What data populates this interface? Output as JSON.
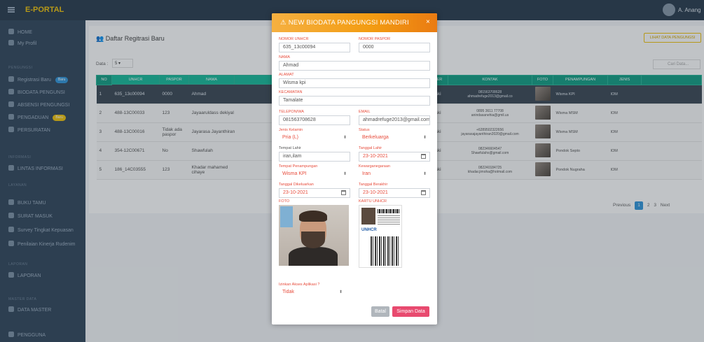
{
  "app": {
    "brand": "E-PORTAL",
    "user_name": "A. Anang"
  },
  "sidebar": {
    "items": [
      {
        "label": "HOME"
      },
      {
        "label": "My Profil"
      },
      {
        "label": "Registrasi Baru",
        "badge": "Baru"
      },
      {
        "label": "BIODATA PENGUNSI"
      },
      {
        "label": "ABSENSI PENGUNGSI"
      },
      {
        "label": "PENGADUAN",
        "badge": "Baru"
      },
      {
        "label": "PERSURATAN"
      },
      {
        "label": "LINTAS INFORMASI"
      },
      {
        "label": "BUKU TAMU"
      },
      {
        "label": "SURAT MASUK"
      },
      {
        "label": "Survey Tingkat Kepuasan"
      },
      {
        "label": "Penilaian Kinerja Rudenim"
      },
      {
        "label": "LAPORAN"
      },
      {
        "label": "DATA MASTER"
      },
      {
        "label": "PENGGUNA"
      }
    ],
    "sections": [
      "PENGUNGSI",
      "INFORMASI",
      "LAYANAN",
      "LAPORAN",
      "MASTER DATA"
    ]
  },
  "page": {
    "title": "Daftar Regitrasi Baru",
    "all_data_button": "LIHAT DATA PENGUNGSI",
    "data_label": "Data :",
    "data_count": "5",
    "search_placeholder": "Cari Data..."
  },
  "table": {
    "headers": [
      "NO",
      "UNHCR",
      "PASPOR",
      "NAMA",
      "GENDER",
      "KONTAK",
      "FOTO",
      "PENAMPUNGAN",
      "JENIS"
    ],
    "rows": [
      {
        "no": "1",
        "unhcr": "635_13c00094",
        "paspor": "0000",
        "nama": "Ahmad",
        "gender": "Laki-Laki",
        "kontak": "081563708628",
        "email": "ahmadrefuge2013@gmail.co",
        "penampungan": "Wisma KPI",
        "jenis": "IOM"
      },
      {
        "no": "2",
        "unhcr": "488-13C00033",
        "paspor": "123",
        "nama": "Jayaaruldass dekiyal",
        "gender": "Laki-Laki",
        "kontak": "0895 3611 77708",
        "email": "anindasanehia@gmil.us",
        "penampungan": "Wisma MSM",
        "jenis": "IOM"
      },
      {
        "no": "3",
        "unhcr": "488-13C00016",
        "paspor": "Tidak ada paspor",
        "nama": "Jayarasa Jayanthiran",
        "gender": "Laki-Laki",
        "kontak": "+6289502322656",
        "email": "jayarasajayanthiran2020@gmail.com",
        "penampungan": "Wisma MSM",
        "jenis": "IOM"
      },
      {
        "no": "4",
        "unhcr": "354-12C00671",
        "paspor": "No",
        "nama": "Shawfulah",
        "gender": "Laki-Laki",
        "kontak": "082346604547",
        "email": "Shawfulahs@gmail.com",
        "penampungan": "Pondok Septo",
        "jenis": "IOM"
      },
      {
        "no": "5",
        "unhcr": "186_14C03555",
        "paspor": "123",
        "nama": "Khadar mahamed cihaye",
        "gender": "Laki-Laki",
        "kontak": "082240184725",
        "email": "khadar.jimoha@hotmail.com",
        "penampungan": "Pondok Nugraha",
        "jenis": "IOM"
      }
    ]
  },
  "pagination": {
    "previous": "Previous",
    "pages": [
      "1",
      "2",
      "3"
    ],
    "next": "Next"
  },
  "modal": {
    "title": "NEW BIODATA PANGUNGSI MANDIRI",
    "close": "×",
    "fields": {
      "nomor_unhcr_label": "NOMOR UNHCR",
      "nomor_unhcr_value": "635_13c00094",
      "nomor_paspor_label": "NOMOR PASPOR",
      "nomor_paspor_value": "0000",
      "nama_label": "NAMA",
      "nama_value": "Ahmad",
      "alamat_label": "ALAMAT",
      "alamat_value": "Wisma kpi",
      "kecamatan_label": "KECAMATAN",
      "kecamatan_value": "Tamalate",
      "telepon_label": "TELEPON/WA",
      "telepon_value": "081563708628",
      "email_label": "EMAIL",
      "email_value": "ahmadrefuge2013@gmail.com",
      "jenis_kelamin_label": "Jenis Kelamin",
      "jenis_kelamin_value": "Pria (L)",
      "status_label": "Status",
      "status_value": "Berkeluarga",
      "tempat_lahir_label": "Tempat Lahir",
      "tempat_lahir_value": "iran,ilam",
      "tanggal_lahir_label": "Tanggal Lahir",
      "tanggal_lahir_value": "23-10-2021",
      "penampungan_label": "Tempat Penampungan",
      "penampungan_value": "Wisma KPI",
      "kewarganegaraan_label": "Kewarganegaraan",
      "kewarganegaraan_value": "Iran",
      "tgl_dikeluarkan_label": "Tanggal Dikeluarkan",
      "tgl_dikeluarkan_value": "23-10-2021",
      "tgl_berakhir_label": "Tanggal Berakhir",
      "tgl_berakhir_value": "23-10-2021",
      "foto_label": "FOTO",
      "kartu_label": "KARTU UNHCR",
      "card_text": "UNHCR",
      "akses_label": "Izinkan Akses Aplikasi ?",
      "akses_value": "Tidak"
    },
    "batal": "Batal",
    "simpan": "Simpan Data"
  },
  "colors": {
    "header": "#2c3e50",
    "sidebar": "#34495e",
    "modal_header": "#f39c12",
    "table_header": "#16a085",
    "save_button": "#e84a6f",
    "field_label": "#e74c3c"
  }
}
